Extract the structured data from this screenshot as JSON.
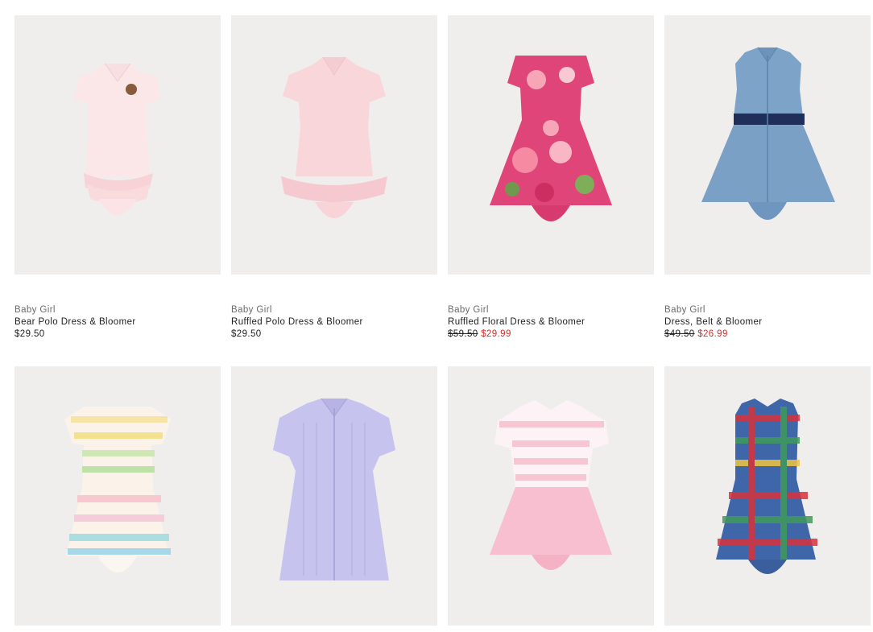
{
  "products": [
    {
      "category": "Baby Girl",
      "name": "Bear Polo Dress & Bloomer",
      "price": "$29.50",
      "original_price": "",
      "sale_price": "",
      "image_icon": "bear-polo-dress-image"
    },
    {
      "category": "Baby Girl",
      "name": "Ruffled Polo Dress & Bloomer",
      "price": "$29.50",
      "original_price": "",
      "sale_price": "",
      "image_icon": "ruffled-polo-dress-image"
    },
    {
      "category": "Baby Girl",
      "name": "Ruffled Floral Dress & Bloomer",
      "price": "",
      "original_price": "$59.50",
      "sale_price": "$29.99",
      "image_icon": "floral-dress-image"
    },
    {
      "category": "Baby Girl",
      "name": "Dress, Belt & Bloomer",
      "price": "",
      "original_price": "$49.50",
      "sale_price": "$26.99",
      "image_icon": "chambray-dress-image"
    },
    {
      "image_icon": "rainbow-stripe-dress-image"
    },
    {
      "image_icon": "lavender-oxford-dress-image"
    },
    {
      "image_icon": "pink-stripe-dress-image"
    },
    {
      "image_icon": "plaid-dress-image"
    }
  ],
  "colors": {
    "tile_bg": "#efeeed",
    "sale_red": "#c8302b",
    "muted": "#6b6b6b",
    "text": "#1f1f1f"
  }
}
